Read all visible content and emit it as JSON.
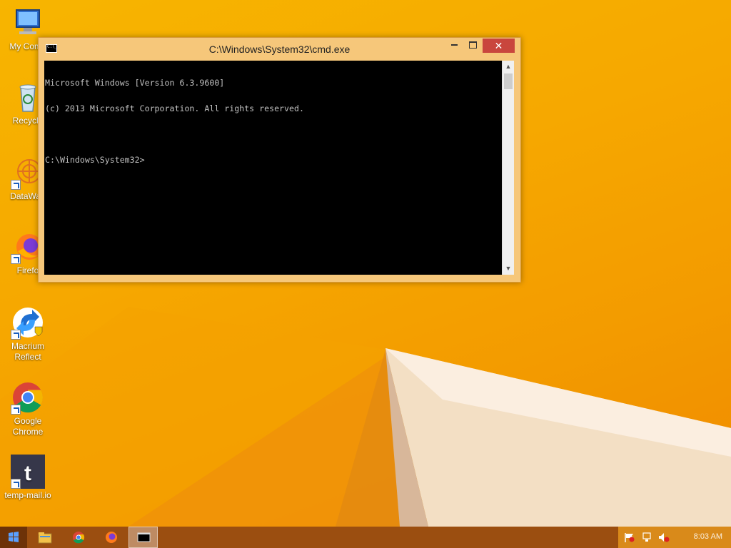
{
  "desktop": {
    "icons": [
      {
        "label": "My Comp",
        "icon": "computer-icon"
      },
      {
        "label": "Recycle",
        "icon": "recycle-bin-icon"
      },
      {
        "label": "DataWag",
        "icon": "datawag-icon"
      },
      {
        "label": "Firefo",
        "icon": "firefox-icon"
      },
      {
        "label": "Macrium Reflect",
        "icon": "macrium-reflect-icon"
      },
      {
        "label": "Google Chrome",
        "icon": "chrome-icon"
      },
      {
        "label": "temp-mail.io",
        "icon": "temp-mail-icon"
      }
    ]
  },
  "cmd_window": {
    "title": "C:\\Windows\\System32\\cmd.exe",
    "minimize_label": "",
    "maximize_label": "",
    "close_label": "✕",
    "console_lines": [
      "Microsoft Windows [Version 6.3.9600]",
      "(c) 2013 Microsoft Corporation. All rights reserved.",
      "",
      "C:\\Windows\\System32>"
    ]
  },
  "taskbar": {
    "items": [
      {
        "name": "start",
        "icon": "windows-logo-icon"
      },
      {
        "name": "file-explorer",
        "icon": "folder-icon"
      },
      {
        "name": "chrome",
        "icon": "chrome-icon"
      },
      {
        "name": "firefox",
        "icon": "firefox-icon"
      },
      {
        "name": "cmd",
        "icon": "cmd-icon"
      }
    ],
    "tray": {
      "clock": "8:03 AM",
      "icons": [
        "flag-icon",
        "network-icon",
        "volume-muted-icon"
      ]
    }
  },
  "colors": {
    "wallpaper": "#f6a800",
    "window_frame": "#f6c77a",
    "close_button": "#c9463d",
    "taskbar": "#9b4e10"
  }
}
